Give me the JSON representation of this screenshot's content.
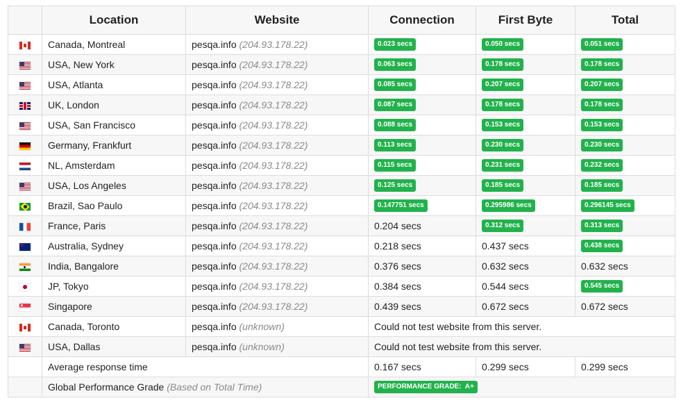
{
  "headers": {
    "location": "Location",
    "website": "Website",
    "connection": "Connection",
    "first_byte": "First Byte",
    "total": "Total"
  },
  "rows": [
    {
      "flag": "canada-flag-icon",
      "location": "Canada, Montreal",
      "site": "pesqa.info",
      "ip": "(204.93.178.22)",
      "connection": "0.023 secs",
      "first_byte": "0.050 secs",
      "total": "0.051 secs"
    },
    {
      "flag": "usa-flag-icon",
      "location": "USA, New York",
      "site": "pesqa.info",
      "ip": "(204.93.178.22)",
      "connection": "0.063 secs",
      "first_byte": "0.178 secs",
      "total": "0.178 secs"
    },
    {
      "flag": "usa-flag-icon",
      "location": "USA, Atlanta",
      "site": "pesqa.info",
      "ip": "(204.93.178.22)",
      "connection": "0.085 secs",
      "first_byte": "0.207 secs",
      "total": "0.207 secs"
    },
    {
      "flag": "uk-flag-icon",
      "location": "UK, London",
      "site": "pesqa.info",
      "ip": "(204.93.178.22)",
      "connection": "0.087 secs",
      "first_byte": "0.178 secs",
      "total": "0.178 secs"
    },
    {
      "flag": "usa-flag-icon",
      "location": "USA, San Francisco",
      "site": "pesqa.info",
      "ip": "(204.93.178.22)",
      "connection": "0.088 secs",
      "first_byte": "0.153 secs",
      "total": "0.153 secs"
    },
    {
      "flag": "germany-flag-icon",
      "location": "Germany, Frankfurt",
      "site": "pesqa.info",
      "ip": "(204.93.178.22)",
      "connection": "0.113 secs",
      "first_byte": "0.230 secs",
      "total": "0.230 secs"
    },
    {
      "flag": "netherlands-flag-icon",
      "location": "NL, Amsterdam",
      "site": "pesqa.info",
      "ip": "(204.93.178.22)",
      "connection": "0.115 secs",
      "first_byte": "0.231 secs",
      "total": "0.232 secs"
    },
    {
      "flag": "usa-flag-icon",
      "location": "USA, Los Angeles",
      "site": "pesqa.info",
      "ip": "(204.93.178.22)",
      "connection": "0.125 secs",
      "first_byte": "0.185 secs",
      "total": "0.185 secs"
    },
    {
      "flag": "brazil-flag-icon",
      "location": "Brazil, Sao Paulo",
      "site": "pesqa.info",
      "ip": "(204.93.178.22)",
      "connection": "0.147751 secs",
      "first_byte": "0.295986 secs",
      "total": "0.296145 secs"
    },
    {
      "flag": "france-flag-icon",
      "location": "France, Paris",
      "site": "pesqa.info",
      "ip": "(204.93.178.22)",
      "connection": "0.204 secs",
      "first_byte": "0.312 secs",
      "total": "0.313 secs"
    },
    {
      "flag": "australia-flag-icon",
      "location": "Australia, Sydney",
      "site": "pesqa.info",
      "ip": "(204.93.178.22)",
      "connection": "0.218 secs",
      "first_byte": "0.437 secs",
      "total": "0.438 secs"
    },
    {
      "flag": "india-flag-icon",
      "location": "India, Bangalore",
      "site": "pesqa.info",
      "ip": "(204.93.178.22)",
      "connection": "0.376 secs",
      "first_byte": "0.632 secs",
      "total": "0.632 secs"
    },
    {
      "flag": "japan-flag-icon",
      "location": "JP, Tokyo",
      "site": "pesqa.info",
      "ip": "(204.93.178.22)",
      "connection": "0.384 secs",
      "first_byte": "0.544 secs",
      "total": "0.545 secs"
    },
    {
      "flag": "singapore-flag-icon",
      "location": "Singapore",
      "site": "pesqa.info",
      "ip": "(204.93.178.22)",
      "connection": "0.439 secs",
      "first_byte": "0.672 secs",
      "total": "0.672 secs"
    }
  ],
  "failed_rows": [
    {
      "flag": "canada-flag-icon",
      "location": "Canada, Toronto",
      "site": "pesqa.info",
      "ip": "(unknown)",
      "message": "Could not test website from this server."
    },
    {
      "flag": "usa-flag-icon",
      "location": "USA, Dallas",
      "site": "pesqa.info",
      "ip": "(unknown)",
      "message": "Could not test website from this server."
    }
  ],
  "average": {
    "label": "Average response time",
    "connection": "0.167 secs",
    "first_byte": "0.299 secs",
    "total": "0.299 secs"
  },
  "grade": {
    "label": "Global Performance Grade",
    "note": "(Based on Total Time)",
    "badge": "PERFORMANCE GRADE:  A+"
  },
  "colors": {
    "badge_green": "#22b24c",
    "row_alt": "#f7f7f7",
    "border": "#dcdcdc"
  }
}
